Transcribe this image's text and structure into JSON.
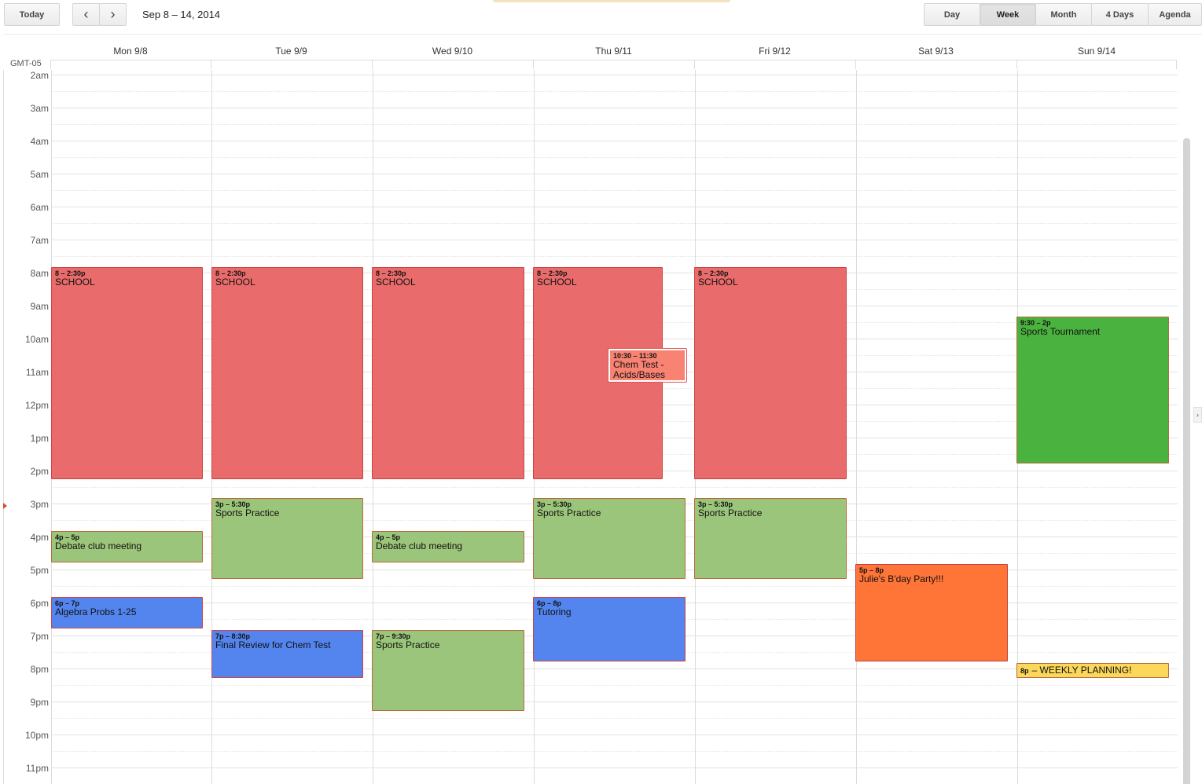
{
  "toolbar": {
    "today_label": "Today",
    "prev_icon": "‹",
    "next_icon": "›",
    "date_range": "Sep 8 – 14, 2014",
    "views": [
      "Day",
      "Week",
      "Month",
      "4 Days",
      "Agenda"
    ],
    "selected_view": "Week"
  },
  "timezone": "GMT-05",
  "days": [
    "Mon 9/8",
    "Tue 9/9",
    "Wed 9/10",
    "Thu 9/11",
    "Fri 9/12",
    "Sat 9/13",
    "Sun 9/14"
  ],
  "hours": [
    "2am",
    "3am",
    "4am",
    "5am",
    "6am",
    "7am",
    "8am",
    "9am",
    "10am",
    "11am",
    "12pm",
    "1pm",
    "2pm",
    "3pm",
    "4pm",
    "5pm",
    "6pm",
    "7pm",
    "8pm",
    "9pm",
    "10pm",
    "11pm"
  ],
  "colors": {
    "school": "#e96b6b",
    "practice": "#9bc57a",
    "study": "#5485ee",
    "party": "#ff7437",
    "tournament": "#4ab23e",
    "planning": "#fbd75b",
    "test": "#f88373"
  },
  "events": [
    {
      "time": "8 – 2:30p",
      "title": "SCHOOL"
    },
    {
      "time": "8 – 2:30p",
      "title": "SCHOOL"
    },
    {
      "time": "8 – 2:30p",
      "title": "SCHOOL"
    },
    {
      "time": "8 – 2:30p",
      "title": "SCHOOL"
    },
    {
      "time": "8 – 2:30p",
      "title": "SCHOOL"
    },
    {
      "time": "10:30 – 11:30",
      "title": "Chem Test - Acids/Bases"
    },
    {
      "time": "9:30 – 2p",
      "title": "Sports Tournament"
    },
    {
      "time": "3p – 5:30p",
      "title": "Sports Practice"
    },
    {
      "time": "3p – 5:30p",
      "title": "Sports Practice"
    },
    {
      "time": "3p – 5:30p",
      "title": "Sports Practice"
    },
    {
      "time": "4p – 5p",
      "title": "Debate club meeting"
    },
    {
      "time": "4p – 5p",
      "title": "Debate club meeting"
    },
    {
      "time": "5p – 8p",
      "title": "Julie's B'day Party!!!"
    },
    {
      "time": "6p – 7p",
      "title": "Algebra Probs 1-25"
    },
    {
      "time": "6p – 8p",
      "title": "Tutoring"
    },
    {
      "time": "7p – 8:30p",
      "title": "Final Review for Chem Test"
    },
    {
      "time": "7p – 9:30p",
      "title": "Sports Practice"
    },
    {
      "time": "8p",
      "title": "– WEEKLY PLANNING!"
    }
  ],
  "side_arrow": "›"
}
